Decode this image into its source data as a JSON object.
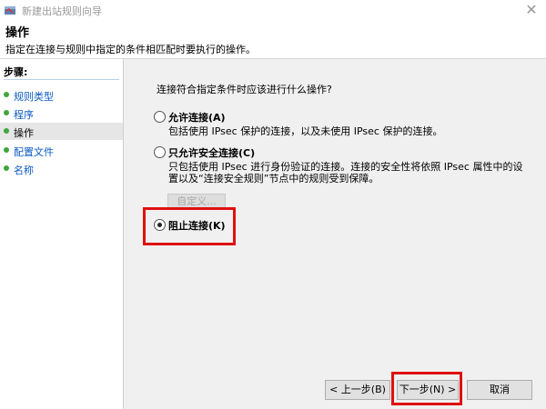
{
  "window": {
    "title": "新建出站规则向导",
    "close_glyph": "✕"
  },
  "header": {
    "title": "操作",
    "subtitle": "指定在连接与规则中指定的条件相匹配时要执行的操作。"
  },
  "steps": {
    "title": "步骤:",
    "items": [
      {
        "label": "规则类型"
      },
      {
        "label": "程序"
      },
      {
        "label": "操作"
      },
      {
        "label": "配置文件"
      },
      {
        "label": "名称"
      }
    ]
  },
  "main": {
    "question": "连接符合指定条件时应该进行什么操作?",
    "options": [
      {
        "label": "允许连接(A)",
        "desc": "包括使用 IPsec 保护的连接，以及未使用 IPsec 保护的连接。"
      },
      {
        "label": "只允许安全连接(C)",
        "desc_line1": "只包括使用 IPsec 进行身份验证的连接。连接的安全性将依照 IPsec 属性中的设",
        "desc_line2": "置以及“连接安全规则”节点中的规则受到保障。"
      },
      {
        "label": "阻止连接(K)",
        "selected": true
      }
    ],
    "customize_label": "自定义..."
  },
  "buttons": {
    "back": "< 上一步(B)",
    "next": "下一步(N) >",
    "cancel": "取消"
  },
  "colors": {
    "highlight": "#e01010",
    "step_dot": "#3ea63e",
    "link": "#0b5bc4"
  }
}
